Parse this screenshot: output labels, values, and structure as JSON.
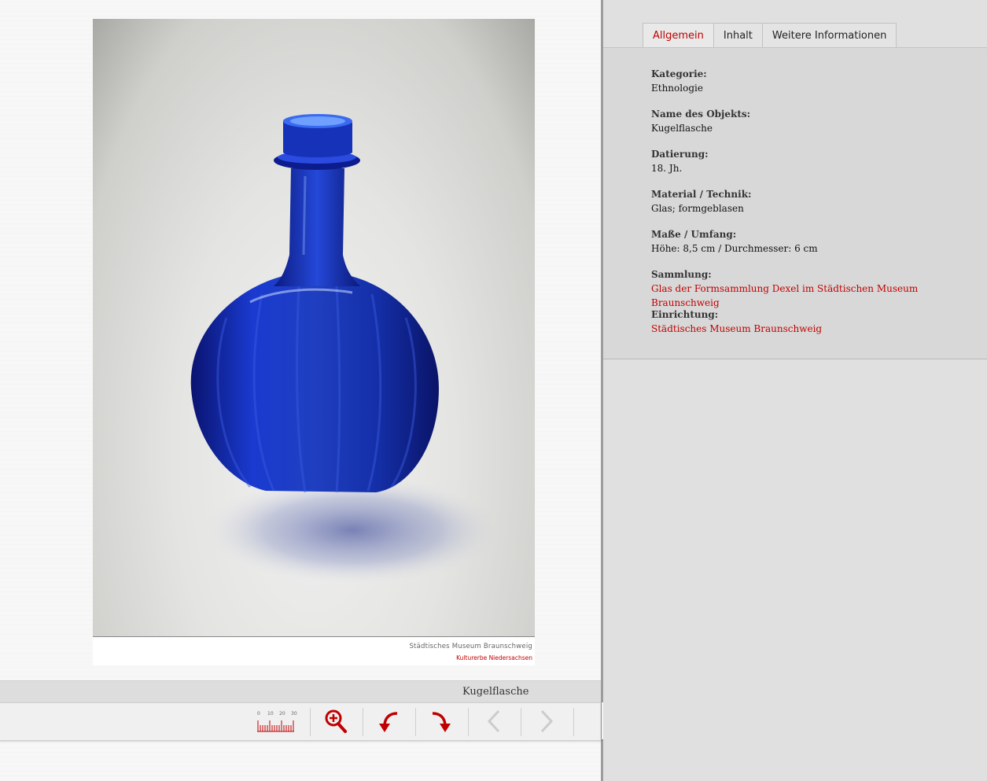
{
  "image": {
    "credit_institution": "Städtisches Museum Braunschweig",
    "credit_network": "Kulturerbe Niedersachsen"
  },
  "caption": "Kugelflasche",
  "toolbar": {
    "scale_labels": [
      "0",
      "10",
      "20",
      "30"
    ],
    "zoom_icon": "zoom-in-icon",
    "rotate_left_icon": "rotate-left-icon",
    "rotate_right_icon": "rotate-right-icon",
    "prev_icon": "chevron-left-icon",
    "next_icon": "chevron-right-icon",
    "accent_color": "#c00000",
    "disabled_color": "#cccccc"
  },
  "tabs": [
    "Allgemein",
    "Inhalt",
    "Weitere Informationen"
  ],
  "fields": [
    {
      "label": "Kategorie:",
      "value": "Ethnologie",
      "link": false
    },
    {
      "label": "Name des Objekts:",
      "value": "Kugelflasche",
      "link": false
    },
    {
      "label": "Datierung:",
      "value": "18. Jh.",
      "link": false
    },
    {
      "label": "Material / Technik:",
      "value": "Glas; formgeblasen",
      "link": false
    },
    {
      "label": "Maße / Umfang:",
      "value": "Höhe: 8,5 cm / Durchmesser: 6 cm",
      "link": false
    },
    {
      "label": "Sammlung:",
      "value": "Glas der Formsammlung Dexel im Städtischen Museum Braunschweig",
      "link": true
    },
    {
      "label": "Einrichtung:",
      "value": "Städtisches Museum Braunschweig",
      "link": true
    }
  ]
}
